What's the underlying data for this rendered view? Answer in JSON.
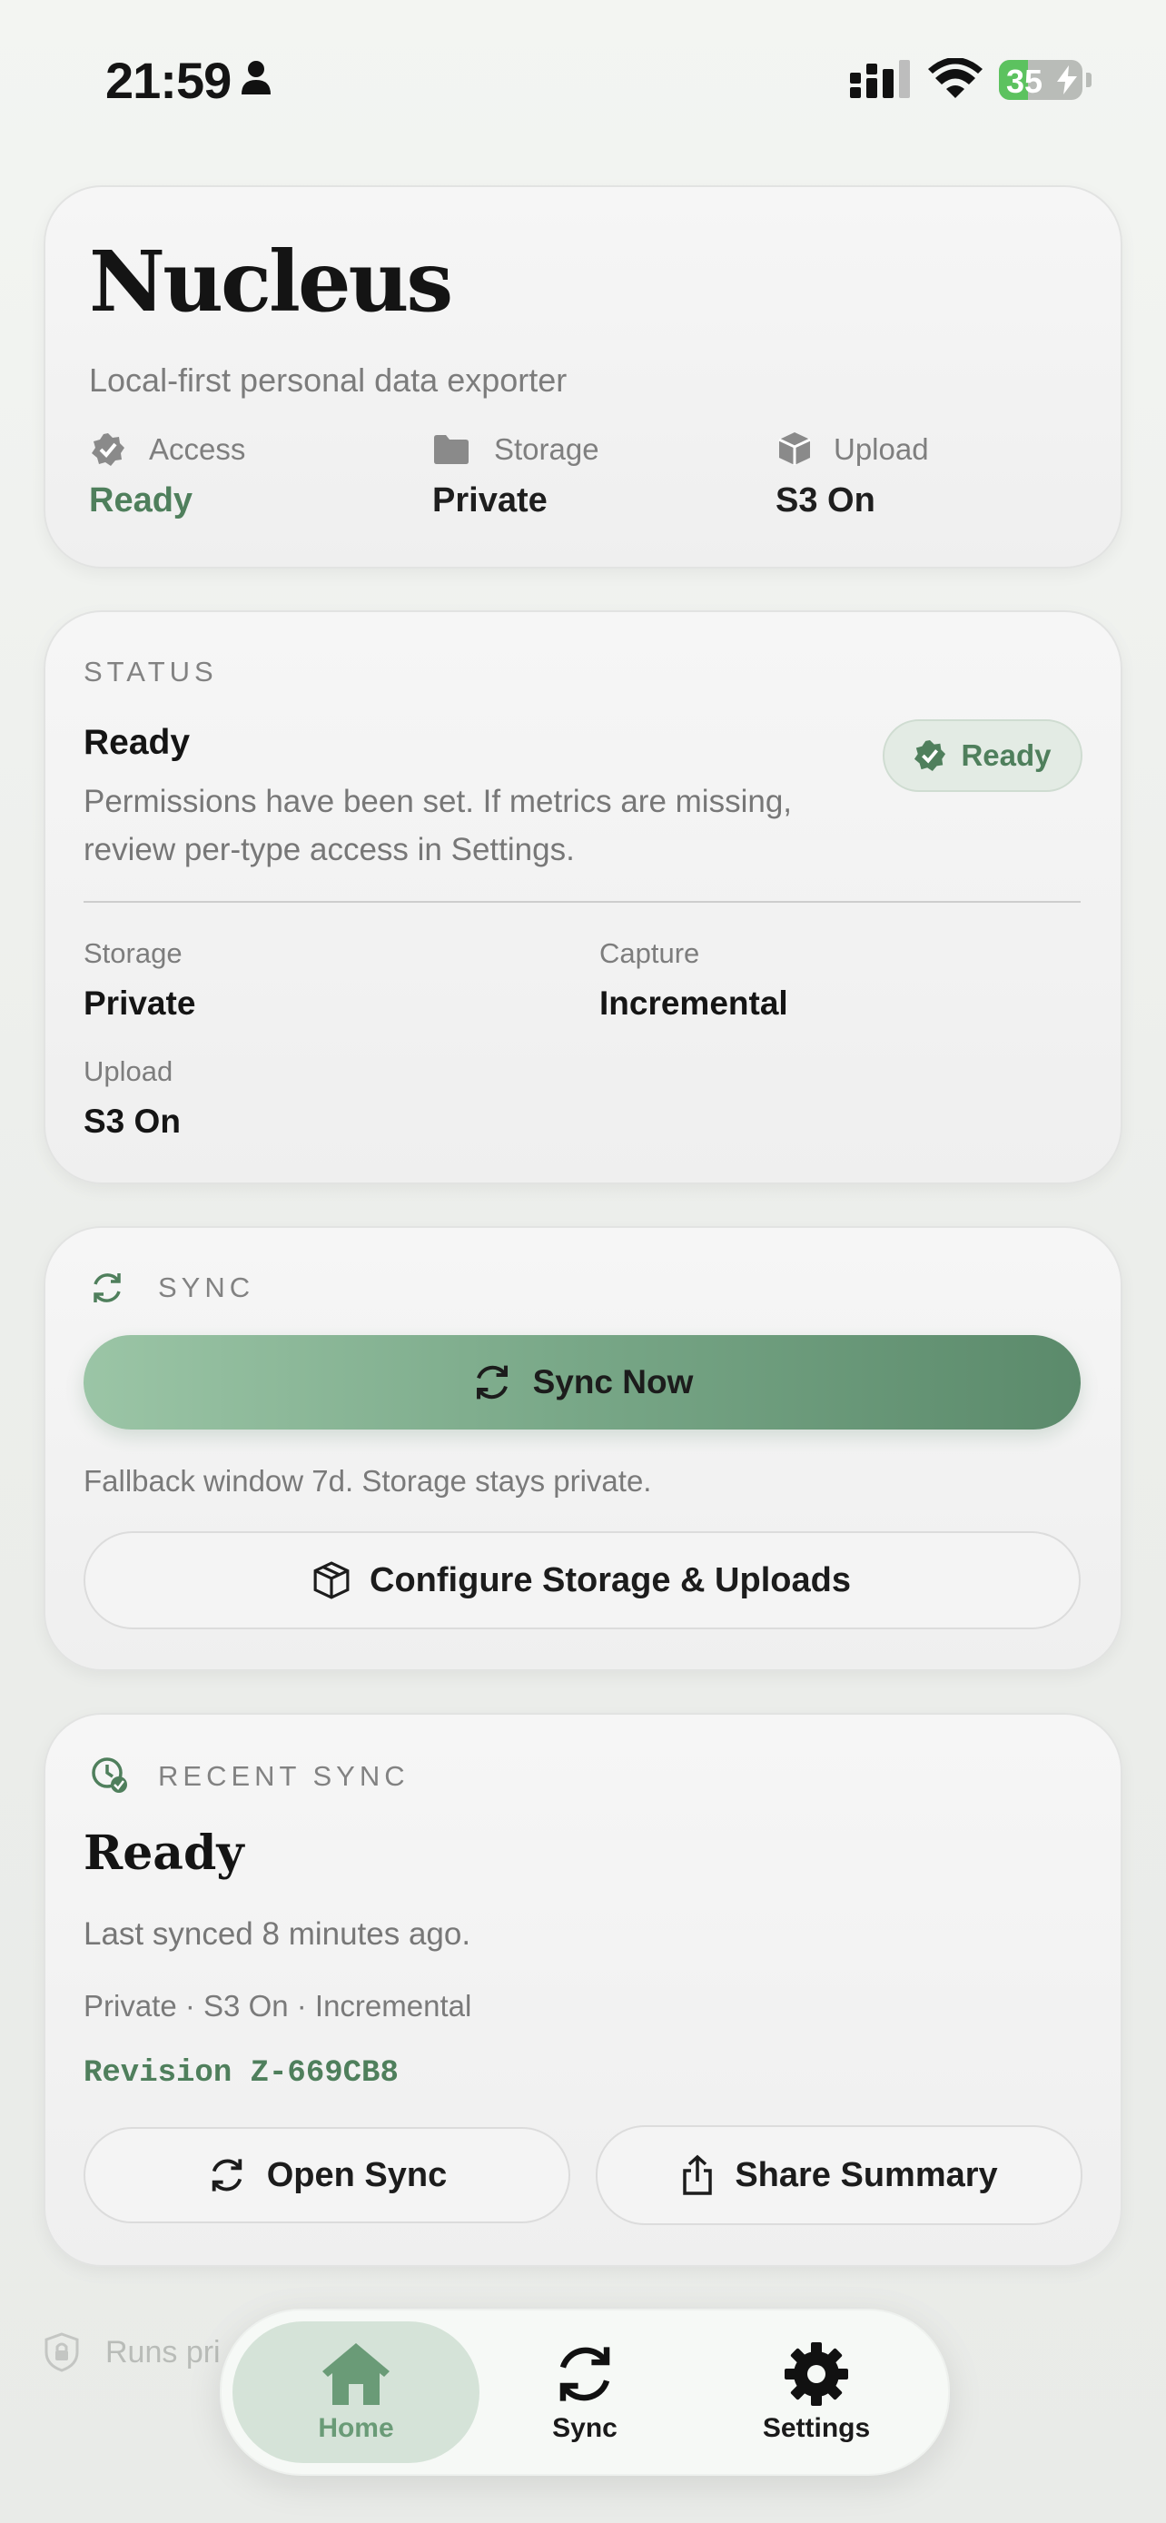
{
  "status_bar": {
    "time": "21:59",
    "battery": "35"
  },
  "hero": {
    "title": "Nucleus",
    "subtitle": "Local-first personal data exporter",
    "meta": [
      {
        "icon": "verified-badge-icon",
        "label": "Access",
        "value": "Ready"
      },
      {
        "icon": "folder-icon",
        "label": "Storage",
        "value": "Private"
      },
      {
        "icon": "cube-icon",
        "label": "Upload",
        "value": "S3 On"
      }
    ]
  },
  "status_card": {
    "section_label": "STATUS",
    "title": "Ready",
    "description": "Permissions have been set. If metrics are missing, review per-type access in Settings.",
    "badge": "Ready",
    "fields": [
      {
        "label": "Storage",
        "value": "Private"
      },
      {
        "label": "Capture",
        "value": "Incremental"
      },
      {
        "label": "Upload",
        "value": "S3 On"
      }
    ]
  },
  "sync_card": {
    "section_label": "SYNC",
    "primary_button": "Sync Now",
    "note": "Fallback window 7d. Storage stays private.",
    "secondary_button": "Configure Storage & Uploads"
  },
  "recent_card": {
    "section_label": "RECENT SYNC",
    "title": "Ready",
    "last_synced": "Last synced 8 minutes ago.",
    "summary": "Private · S3 On · Incremental",
    "revision": "Revision Z-669CB8",
    "open_button": "Open Sync",
    "share_button": "Share Summary"
  },
  "footer": {
    "text": "Runs pri"
  },
  "tabbar": {
    "tabs": [
      {
        "label": "Home",
        "icon": "home-icon",
        "active": true
      },
      {
        "label": "Sync",
        "icon": "sync-icon",
        "active": false
      },
      {
        "label": "Settings",
        "icon": "gear-icon",
        "active": false
      }
    ]
  },
  "colors": {
    "accent": "#4f7f5c",
    "accent_light": "#9bc5a6",
    "tab_active": "#d5e3d8"
  }
}
